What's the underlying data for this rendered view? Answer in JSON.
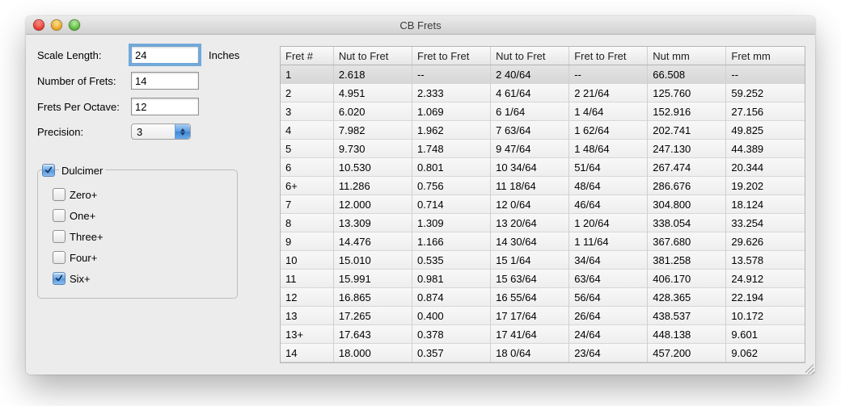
{
  "window": {
    "title": "CB Frets"
  },
  "form": {
    "scale_length": {
      "label": "Scale Length:",
      "value": "24",
      "unit": "Inches"
    },
    "number_of_frets": {
      "label": "Number of Frets:",
      "value": "14"
    },
    "frets_per_octave": {
      "label": "Frets Per Octave:",
      "value": "12"
    },
    "precision": {
      "label": "Precision:",
      "value": "3"
    }
  },
  "dulcimer": {
    "label": "Dulcimer",
    "checked": true,
    "options": [
      {
        "label": "Zero+",
        "checked": false
      },
      {
        "label": "One+",
        "checked": false
      },
      {
        "label": "Three+",
        "checked": false
      },
      {
        "label": "Four+",
        "checked": false
      },
      {
        "label": "Six+",
        "checked": true
      }
    ]
  },
  "table": {
    "headers": [
      "Fret #",
      "Nut to Fret",
      "Fret to Fret",
      "Nut to Fret",
      "Fret to Fret",
      "Nut mm",
      "Fret mm"
    ],
    "selected_index": 0,
    "rows": [
      [
        "1",
        "2.618",
        "--",
        "2 40/64",
        "--",
        "66.508",
        "--"
      ],
      [
        "2",
        "4.951",
        "2.333",
        "4 61/64",
        "2 21/64",
        "125.760",
        "59.252"
      ],
      [
        "3",
        "6.020",
        "1.069",
        "6 1/64",
        "1 4/64",
        "152.916",
        "27.156"
      ],
      [
        "4",
        "7.982",
        "1.962",
        "7 63/64",
        "1 62/64",
        "202.741",
        "49.825"
      ],
      [
        "5",
        "9.730",
        "1.748",
        "9 47/64",
        "1 48/64",
        "247.130",
        "44.389"
      ],
      [
        "6",
        "10.530",
        "0.801",
        "10 34/64",
        "51/64",
        "267.474",
        "20.344"
      ],
      [
        "6+",
        "11.286",
        "0.756",
        "11 18/64",
        "48/64",
        "286.676",
        "19.202"
      ],
      [
        "7",
        "12.000",
        "0.714",
        "12 0/64",
        "46/64",
        "304.800",
        "18.124"
      ],
      [
        "8",
        "13.309",
        "1.309",
        "13 20/64",
        "1 20/64",
        "338.054",
        "33.254"
      ],
      [
        "9",
        "14.476",
        "1.166",
        "14 30/64",
        "1 11/64",
        "367.680",
        "29.626"
      ],
      [
        "10",
        "15.010",
        "0.535",
        "15 1/64",
        "34/64",
        "381.258",
        "13.578"
      ],
      [
        "11",
        "15.991",
        "0.981",
        "15 63/64",
        "63/64",
        "406.170",
        "24.912"
      ],
      [
        "12",
        "16.865",
        "0.874",
        "16 55/64",
        "56/64",
        "428.365",
        "22.194"
      ],
      [
        "13",
        "17.265",
        "0.400",
        "17 17/64",
        "26/64",
        "438.537",
        "10.172"
      ],
      [
        "13+",
        "17.643",
        "0.378",
        "17 41/64",
        "24/64",
        "448.138",
        "9.601"
      ],
      [
        "14",
        "18.000",
        "0.357",
        "18 0/64",
        "23/64",
        "457.200",
        "9.062"
      ]
    ]
  }
}
